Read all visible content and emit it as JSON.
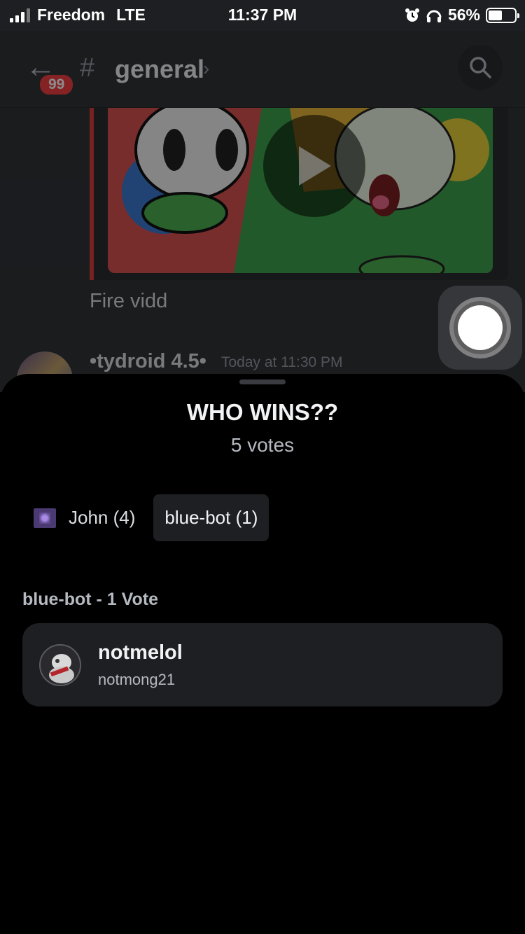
{
  "status_bar": {
    "carrier": "Freedom",
    "network": "LTE",
    "time": "11:37 PM",
    "battery_percent": "56%"
  },
  "chat_header": {
    "unread_badge": "99",
    "hash": "#",
    "channel_name": "general",
    "chevron": "›"
  },
  "messages": [
    {
      "text": "Fire vidd"
    },
    {
      "author": "•tydroid 4.5•",
      "timestamp": "Today at 11:30 PM"
    }
  ],
  "poll": {
    "title": "WHO WINS??",
    "votes_text": "5 votes",
    "tabs": [
      {
        "label": "John (4)",
        "icon": "purple-emoji-icon",
        "active": false
      },
      {
        "label": "blue-bot (1)",
        "active": true
      }
    ],
    "section_label": "blue-bot - 1 Vote",
    "voters": [
      {
        "display_name": "notmelol",
        "username": "notmong21"
      }
    ]
  },
  "colors": {
    "accent_red": "#f23f43",
    "sheet_bg": "#000000",
    "card_bg": "#1e1f22"
  }
}
